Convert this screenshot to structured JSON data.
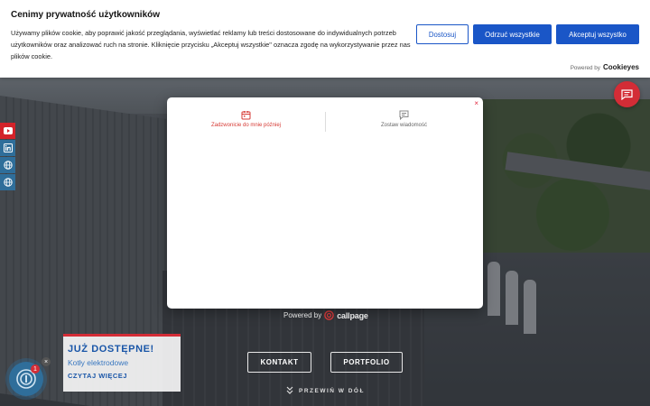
{
  "cookie_banner": {
    "title": "Cenimy prywatność użytkowników",
    "text": "Używamy plików cookie, aby poprawić jakość przeglądania, wyświetlać reklamy lub treści dostosowane do indywidualnych potrzeb użytkowników oraz analizować ruch na stronie. Kliknięcie przycisku „Akceptuj wszystkie\" oznacza zgodę na wykorzystywanie przez nas plików cookie.",
    "buttons": {
      "customize": "Dostosuj",
      "reject": "Odrzuć wszystkie",
      "accept": "Akceptuj wszystko"
    },
    "powered_by": "Powered by",
    "powered_brand": "Cookieyes"
  },
  "callpage_modal": {
    "close_glyph": "×",
    "tabs": [
      {
        "label": "Zadzwonicie do mnie później",
        "icon": "calendar-icon",
        "active": true
      },
      {
        "label": "Zostaw wiadomość",
        "icon": "message-icon",
        "active": false
      }
    ],
    "powered_text": "Powered by",
    "powered_brand": "callpage"
  },
  "hero": {
    "contact_label": "KONTAKT",
    "portfolio_label": "PORTFOLIO",
    "scroll_label": "PRZEWIŃ W DÓŁ"
  },
  "promo": {
    "heading": "JUŻ DOSTĘPNE!",
    "subtitle": "Kotły elektrodowe",
    "more": "CZYTAJ WIĘCEJ",
    "close_glyph": "×"
  },
  "widget": {
    "badge_count": "1"
  },
  "social": [
    "youtube-icon",
    "linkedin-icon",
    "globe-icon",
    "globe-icon"
  ],
  "colors": {
    "brand_blue": "#1a56c7",
    "brand_red": "#d32c36",
    "callpage_active": "#d63a34"
  }
}
